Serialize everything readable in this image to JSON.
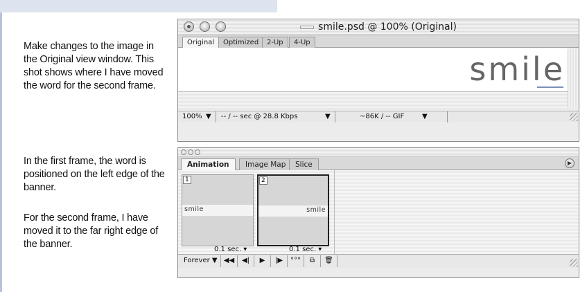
{
  "captions": {
    "p1": "Make changes to the image in the Original view window. This shot shows where I have moved the word for the second frame.",
    "p2": "In the first frame, the word is positioned on the left edge of the banner.",
    "p3": "For the second frame, I have moved it to the far right edge of the banner."
  },
  "main_window": {
    "title": "smile.psd @ 100% (Original)",
    "tabs": [
      "Original",
      "Optimized",
      "2-Up",
      "4-Up"
    ],
    "active_tab": "Original",
    "canvas_word": "smile",
    "status": {
      "zoom": "100%",
      "download": "-- / -- sec @ 28.8 Kbps",
      "size": "~86K / -- GIF"
    }
  },
  "animation_palette": {
    "tabs": [
      "Animation",
      "Image Map",
      "Slice"
    ],
    "active_tab": "Animation",
    "frames": [
      {
        "number": "1",
        "word": "smile",
        "delay": "0.1 sec.",
        "word_position": "left"
      },
      {
        "number": "2",
        "word": "smile",
        "delay": "0.1 sec.",
        "word_position": "right",
        "selected": true
      }
    ],
    "loop": "Forever",
    "controls": [
      "first-frame-icon",
      "previous-frame-icon",
      "play-icon",
      "next-frame-icon",
      "tween-icon",
      "new-frame-icon",
      "trash-icon"
    ]
  },
  "colors": {
    "header_band": "#dde4f0",
    "left_rule": "#b7c3d8",
    "canvas_text": "#666666"
  }
}
